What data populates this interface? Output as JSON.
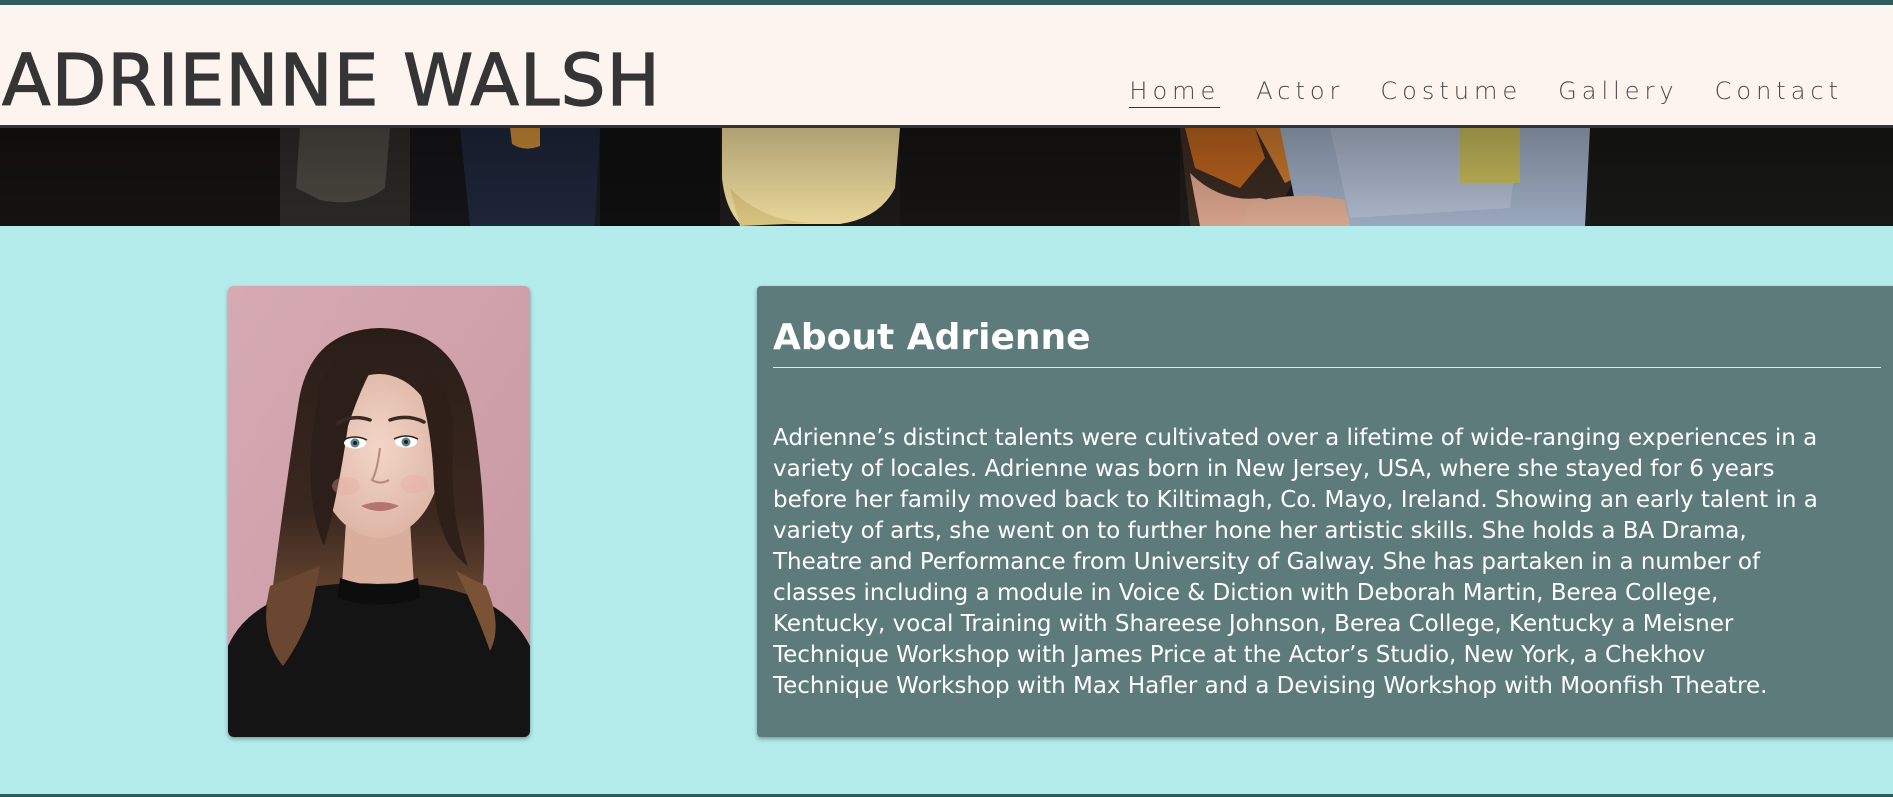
{
  "site": {
    "title": "ADRIENNE WALSH"
  },
  "nav": {
    "items": [
      {
        "label": "Home",
        "active": true
      },
      {
        "label": "Actor",
        "active": false
      },
      {
        "label": "Costume",
        "active": false
      },
      {
        "label": "Gallery",
        "active": false
      },
      {
        "label": "Contact",
        "active": false
      }
    ]
  },
  "about": {
    "heading": "About Adrienne",
    "lines": [
      "Adrienne’s distinct talents were cultivated over a lifetime of wide-ranging experiences in a",
      "variety of locales. Adrienne was born in New Jersey, USA, where she stayed for 6 years",
      "before her family moved back to Kiltimagh, Co. Mayo, Ireland. Showing an early talent in a",
      "variety of arts, she went on to further hone her artistic skills. She holds a BA Drama,",
      "Theatre and Performance from University of Galway. She has partaken in a number of",
      "classes including a module in Voice & Diction with Deborah Martin, Berea College,",
      "Kentucky, vocal Training with Shareese Johnson, Berea College, Kentucky a Meisner",
      "Technique Workshop with James Price at the Actor’s Studio, New York, a Chekhov",
      "Technique Workshop with Max Hafler and a Devising Workshop with Moonfish Theatre."
    ]
  },
  "colors": {
    "page_background": "#b4ecec",
    "header_background": "#fdf3ef",
    "accent_rule": "#2f5d5e",
    "about_card_background": "#5e7b7c",
    "title_text": "#353535"
  }
}
